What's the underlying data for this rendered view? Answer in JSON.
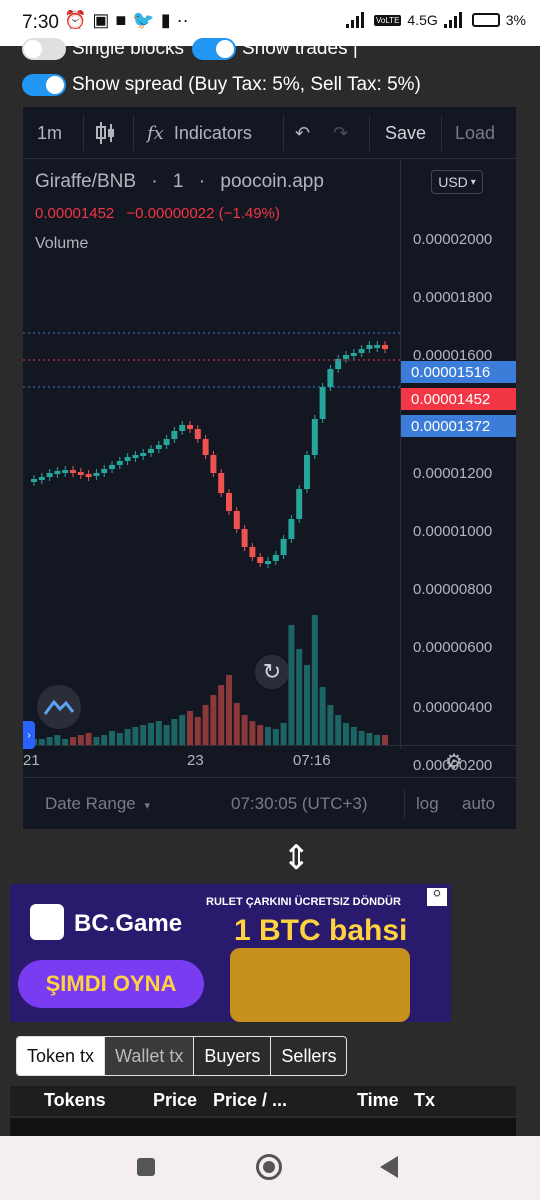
{
  "status_bar": {
    "time": "7:30",
    "battery": "3%",
    "network": "4.5G",
    "lte": "VoLTE"
  },
  "toggles": {
    "single_blocks": "Single blocks",
    "show_trades": "Show trades |",
    "show_spread": "Show spread (Buy Tax: 5%, Sell Tax: 5%)"
  },
  "toolbar": {
    "interval": "1m",
    "indicators": "Indicators",
    "save": "Save",
    "load": "Load"
  },
  "legend": {
    "pair": "Giraffe/BNB",
    "interval": "1",
    "source": "poocoin.app",
    "price": "0.00001452",
    "change": "−0.00000022 (−1.49%)",
    "volume": "Volume"
  },
  "currency": "USD",
  "price_axis": {
    "labels": [
      "0.00002000",
      "0.00001800",
      "0.00001600",
      "0.00001200",
      "0.00001000",
      "0.00000800",
      "0.00000600",
      "0.00000400",
      "0.00000200"
    ],
    "tag_high": "0.00001516",
    "tag_last": "0.00001452",
    "tag_low": "0.00001372"
  },
  "time_axis": {
    "labels": [
      "21",
      "23",
      "07:16"
    ]
  },
  "bottom_bar": {
    "date_range": "Date Range",
    "clock": "07:30:05 (UTC+3)",
    "log": "log",
    "auto": "auto"
  },
  "banner": {
    "brand": "BC.Game",
    "promo": "RULET ÇARKINI ÜCRETSIZ DÖNDÜR",
    "headline": "1 BTC bahsi",
    "cta": "ŞIMDI OYNA"
  },
  "tabs": [
    "Token tx",
    "Wallet tx",
    "Buyers",
    "Sellers"
  ],
  "table_headers": [
    "Tokens",
    "Price",
    "Price / ...",
    "Time",
    "Tx"
  ],
  "colors": {
    "up": "#26a69a",
    "down": "#ef5350",
    "accent": "#2196f3",
    "chart_bg": "#131722"
  }
}
